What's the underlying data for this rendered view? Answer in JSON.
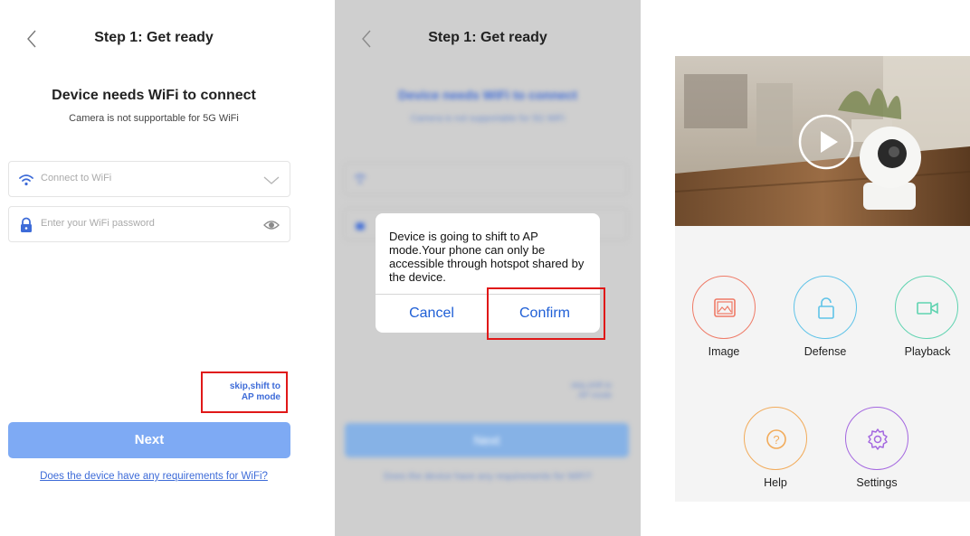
{
  "screen1": {
    "title": "Step 1: Get ready",
    "heading": "Device needs WiFi to connect",
    "subheading": "Camera is not supportable for 5G WiFi",
    "wifi_field": {
      "placeholder": "Connect to WiFi"
    },
    "password_field": {
      "placeholder": "Enter your WiFi password"
    },
    "skip_link": {
      "line1": "skip,shift to",
      "line2": "AP mode"
    },
    "next_label": "Next",
    "requirements_link": "Does the device have any requirements for WiFi?"
  },
  "screen2": {
    "title": "Step 1: Get ready",
    "dialog": {
      "message": "Device is going to shift to AP mode.Your phone can only be accessible through hotspot shared by the device.",
      "cancel_label": "Cancel",
      "confirm_label": "Confirm"
    }
  },
  "screen3": {
    "buttons": [
      {
        "label": "Image",
        "icon": "image-icon",
        "color": "#ef7a66"
      },
      {
        "label": "Defense",
        "icon": "unlock-icon",
        "color": "#5fc3e8"
      },
      {
        "label": "Playback",
        "icon": "video-camera-icon",
        "color": "#5fd3b0"
      },
      {
        "label": "Help",
        "icon": "help-icon",
        "color": "#f2ab5a"
      },
      {
        "label": "Settings",
        "icon": "gear-icon",
        "color": "#a467e0"
      }
    ]
  },
  "colors": {
    "accent_blue": "#3d6bd8",
    "next_button": "#7eaaf4",
    "highlight_red": "#e01818"
  }
}
